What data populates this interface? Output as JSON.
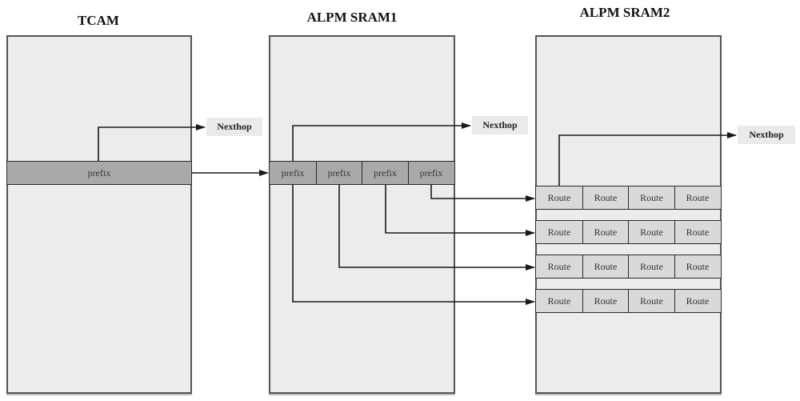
{
  "diagram": {
    "columns": [
      {
        "id": "tcam",
        "title": "TCAM",
        "entry_label": "prefix",
        "entry_count": 1
      },
      {
        "id": "sram1",
        "title": "ALPM SRAM1",
        "entry_label": "prefix",
        "entry_count": 4
      },
      {
        "id": "sram2",
        "title": "ALPM SRAM2",
        "entry_label": "Route",
        "rows": 4,
        "entries_per_row": 4
      }
    ],
    "nexthop_label": "Nexthop",
    "tcam": {
      "title": "TCAM",
      "prefix": [
        "prefix"
      ],
      "nexthop": "Nexthop"
    },
    "sram1": {
      "title": "ALPM SRAM1",
      "prefixes": [
        "prefix",
        "prefix",
        "prefix",
        "prefix"
      ],
      "nexthop": "Nexthop"
    },
    "sram2": {
      "title": "ALPM SRAM2",
      "route_rows": [
        [
          "Route",
          "Route",
          "Route",
          "Route"
        ],
        [
          "Route",
          "Route",
          "Route",
          "Route"
        ],
        [
          "Route",
          "Route",
          "Route",
          "Route"
        ],
        [
          "Route",
          "Route",
          "Route",
          "Route"
        ]
      ],
      "nexthop": "Nexthop"
    },
    "connections": [
      {
        "from": "tcam.prefix.0",
        "to": "nexthop-tcam"
      },
      {
        "from": "tcam.prefix.0",
        "to": "sram1.prefix-row"
      },
      {
        "from": "sram1.prefix.0",
        "to": "nexthop-sram1"
      },
      {
        "from": "sram1.prefix.3",
        "to": "sram2.route_rows.0"
      },
      {
        "from": "sram1.prefix.2",
        "to": "sram2.route_rows.1"
      },
      {
        "from": "sram1.prefix.1",
        "to": "sram2.route_rows.2"
      },
      {
        "from": "sram1.prefix.0",
        "to": "sram2.route_rows.3"
      },
      {
        "from": "sram2.route_rows.0.0",
        "to": "nexthop-sram2"
      }
    ],
    "colors": {
      "memory_fill": "#ececec",
      "border": "#555555",
      "prefix_fill": "#a9a9a9",
      "route_fill": "#d9d9d9",
      "nexthop_fill": "#eaeaea",
      "wire": "#1a1a1a"
    }
  }
}
